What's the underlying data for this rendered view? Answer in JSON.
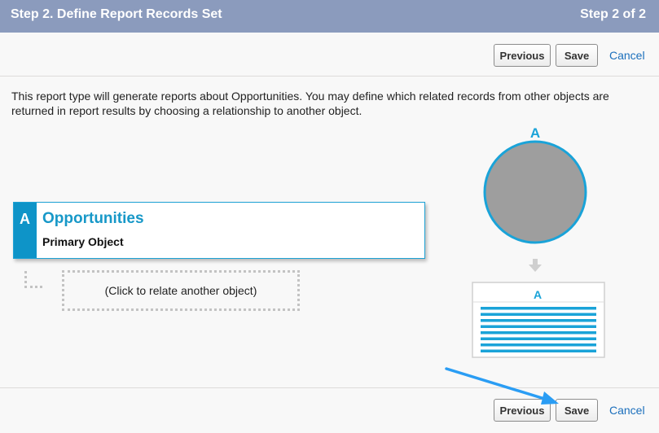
{
  "header": {
    "title": "Step 2. Define Report Records Set",
    "step": "Step 2 of 2"
  },
  "toolbar": {
    "previous_label": "Previous",
    "save_label": "Save",
    "cancel_label": "Cancel"
  },
  "description": "This report type will generate reports about Opportunities. You may define which related records from other objects are returned in report results by choosing a relationship to another object.",
  "primary_object": {
    "letter": "A",
    "name": "Opportunities",
    "subtitle": "Primary Object"
  },
  "relate_placeholder": "(Click to relate another object)",
  "diagram": {
    "circle_letter": "A",
    "table_letter": "A",
    "circle_color": "#9e9e9e",
    "accent_color": "#1aa3d8"
  },
  "colors": {
    "header_bg": "#8b9bbd",
    "link": "#1b6fbc",
    "accent": "#1798c8"
  }
}
